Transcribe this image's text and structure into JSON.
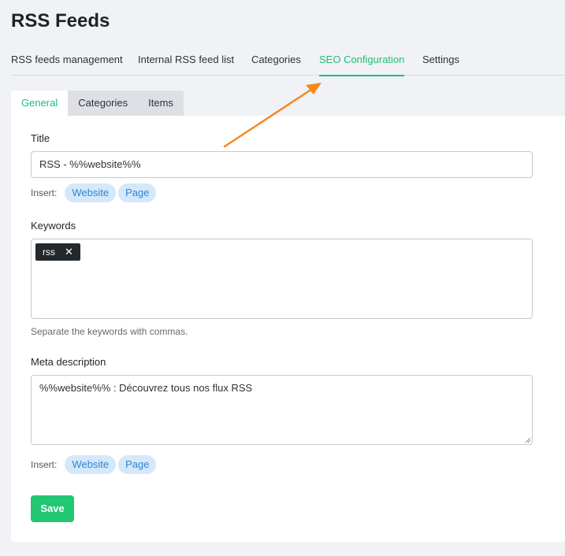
{
  "page": {
    "title": "RSS Feeds"
  },
  "main_tabs": [
    {
      "label": "RSS feeds management"
    },
    {
      "label": "Internal RSS feed list"
    },
    {
      "label": "Categories"
    },
    {
      "label": "SEO Configuration",
      "active": true
    },
    {
      "label": "Settings"
    }
  ],
  "sub_tabs": [
    {
      "label": "General",
      "active": true
    },
    {
      "label": "Categories"
    },
    {
      "label": "Items"
    }
  ],
  "form": {
    "title_label": "Title",
    "title_value": "RSS - %%website%%",
    "insert_label": "Insert:",
    "insert_options": [
      "Website",
      "Page"
    ],
    "keywords_label": "Keywords",
    "keywords": [
      "rss"
    ],
    "keywords_help": "Separate the keywords with commas.",
    "meta_label": "Meta description",
    "meta_value": "%%website%% : Découvrez tous nos flux RSS",
    "save_label": "Save"
  },
  "colors": {
    "accent": "#1ebd7b",
    "save_button": "#22c773",
    "pill_bg": "#d5e8fb",
    "pill_text": "#2e86d6",
    "annotation_arrow": "#f5891f"
  },
  "icons": {
    "tag_remove": "close-icon"
  }
}
